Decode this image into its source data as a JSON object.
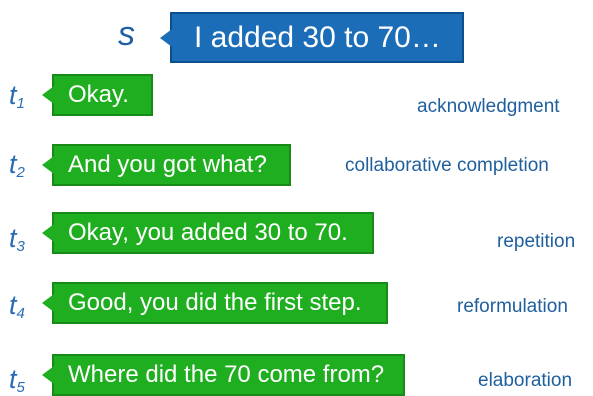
{
  "student": {
    "speaker": "s",
    "utterance": "I added 30 to 70…"
  },
  "turns": [
    {
      "speaker": "t",
      "index": "1",
      "utterance": "Okay.",
      "label": "acknowledgment"
    },
    {
      "speaker": "t",
      "index": "2",
      "utterance": "And you got what?",
      "label": "collaborative completion"
    },
    {
      "speaker": "t",
      "index": "3",
      "utterance": "Okay, you added 30 to 70.",
      "label": "repetition"
    },
    {
      "speaker": "t",
      "index": "4",
      "utterance": "Good, you did the first step.",
      "label": "reformulation"
    },
    {
      "speaker": "t",
      "index": "5",
      "utterance": "Where did the 70 come from?",
      "label": "elaboration"
    }
  ],
  "colors": {
    "student_bubble": "#1c6db8",
    "teacher_bubble": "#1fae1f",
    "label_text": "#1f5f9e"
  }
}
